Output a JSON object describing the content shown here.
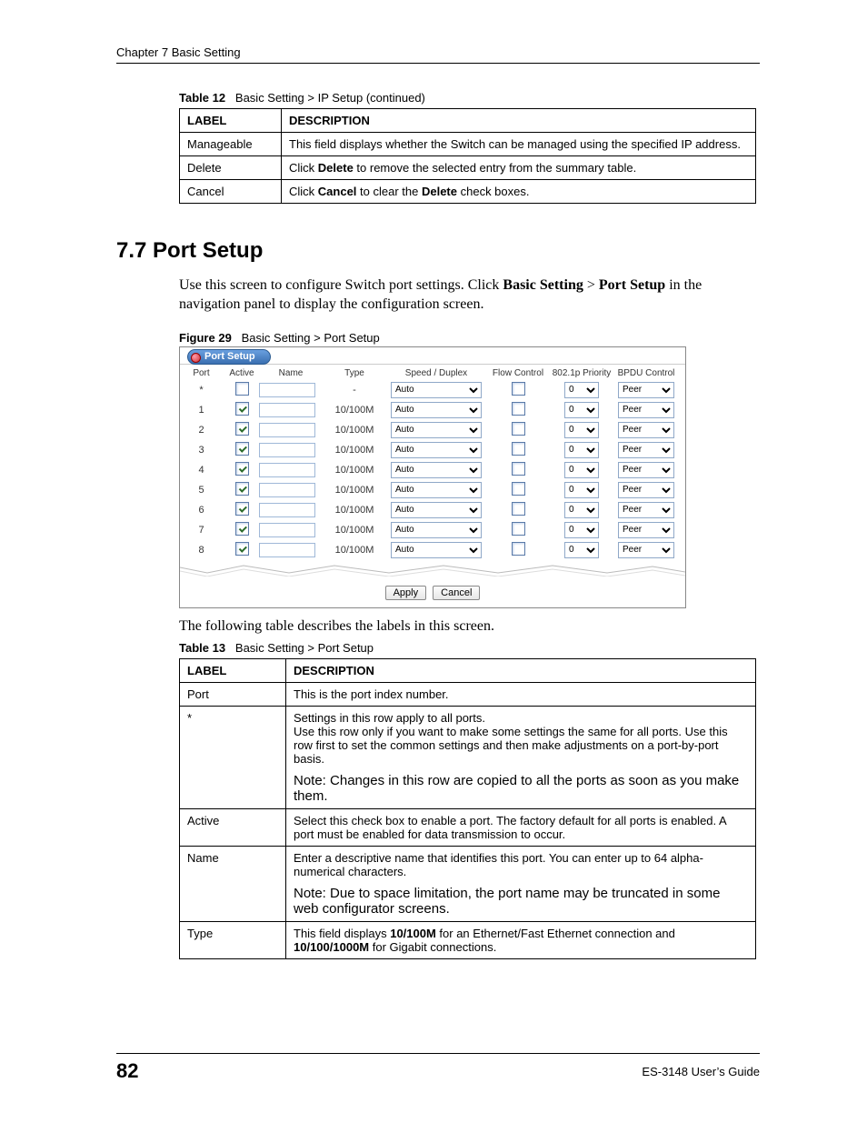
{
  "header": {
    "chapter": "Chapter 7 Basic Setting"
  },
  "table12": {
    "caption_label": "Table 12",
    "caption_text": "Basic Setting > IP Setup (continued)",
    "header_label": "LABEL",
    "header_desc": "DESCRIPTION",
    "rows": [
      {
        "label": "Manageable",
        "desc": "This field displays whether the Switch can be managed using the specified IP address."
      },
      {
        "label": "Delete",
        "desc_pre": "Click ",
        "desc_b1": "Delete",
        "desc_post": " to remove the selected entry from the summary table."
      },
      {
        "label": "Cancel",
        "desc_pre": "Click ",
        "desc_b1": "Cancel",
        "desc_mid": " to clear the ",
        "desc_b2": "Delete",
        "desc_post": " check boxes."
      }
    ]
  },
  "section": {
    "heading": "7.7  Port Setup",
    "para_pre": "Use this screen to configure Switch port settings. Click ",
    "para_b1": "Basic Setting",
    "para_gt": " > ",
    "para_b2": "Port Setup",
    "para_post": " in the navigation panel to display the configuration screen."
  },
  "figure29": {
    "caption_label": "Figure 29",
    "caption_text": "Basic Setting > Port Setup"
  },
  "screenshot": {
    "title": "Port Setup",
    "col_port": "Port",
    "col_active": "Active",
    "col_name": "Name",
    "col_type": "Type",
    "col_speed": "Speed / Duplex",
    "col_flow": "Flow Control",
    "col_prio": "802.1p Priority",
    "col_bpdu": "BPDU Control",
    "rows": [
      {
        "port": "*",
        "active": false,
        "type": "-",
        "speed": "Auto",
        "prio": "0",
        "bpdu": "Peer"
      },
      {
        "port": "1",
        "active": true,
        "type": "10/100M",
        "speed": "Auto",
        "prio": "0",
        "bpdu": "Peer"
      },
      {
        "port": "2",
        "active": true,
        "type": "10/100M",
        "speed": "Auto",
        "prio": "0",
        "bpdu": "Peer"
      },
      {
        "port": "3",
        "active": true,
        "type": "10/100M",
        "speed": "Auto",
        "prio": "0",
        "bpdu": "Peer"
      },
      {
        "port": "4",
        "active": true,
        "type": "10/100M",
        "speed": "Auto",
        "prio": "0",
        "bpdu": "Peer"
      },
      {
        "port": "5",
        "active": true,
        "type": "10/100M",
        "speed": "Auto",
        "prio": "0",
        "bpdu": "Peer"
      },
      {
        "port": "6",
        "active": true,
        "type": "10/100M",
        "speed": "Auto",
        "prio": "0",
        "bpdu": "Peer"
      },
      {
        "port": "7",
        "active": true,
        "type": "10/100M",
        "speed": "Auto",
        "prio": "0",
        "bpdu": "Peer"
      },
      {
        "port": "8",
        "active": true,
        "type": "10/100M",
        "speed": "Auto",
        "prio": "0",
        "bpdu": "Peer"
      }
    ],
    "apply": "Apply",
    "cancel": "Cancel"
  },
  "after_screenshot_para": "The following table describes the labels in this screen.",
  "table13": {
    "caption_label": "Table 13",
    "caption_text": "Basic Setting > Port Setup",
    "header_label": "LABEL",
    "header_desc": "DESCRIPTION",
    "rows": {
      "port": {
        "label": "Port",
        "desc": "This is the port index number."
      },
      "star": {
        "label": "*",
        "line1": "Settings in this row apply to all ports.",
        "line2": "Use this row only if you want to make some settings the same for all ports. Use this row first to set the common settings and then make adjustments on a port-by-port basis.",
        "note": "Note: Changes in this row are copied to all the ports as soon as you make them."
      },
      "active": {
        "label": "Active",
        "desc": "Select this check box to enable a port. The factory default for all ports is enabled. A port must be enabled for data transmission to occur."
      },
      "name": {
        "label": "Name",
        "desc": "Enter a descriptive name that identifies this port. You can enter up to 64 alpha-numerical characters.",
        "note": "Note: Due to space limitation, the port name may be truncated in some web configurator screens."
      },
      "type": {
        "label": "Type",
        "pre": "This field displays ",
        "b1": "10/100M",
        "mid": " for an Ethernet/Fast Ethernet connection and ",
        "b2": "10/100/1000M",
        "post": " for Gigabit connections."
      }
    }
  },
  "footer": {
    "page": "82",
    "guide": "ES-3148 User’s Guide"
  }
}
